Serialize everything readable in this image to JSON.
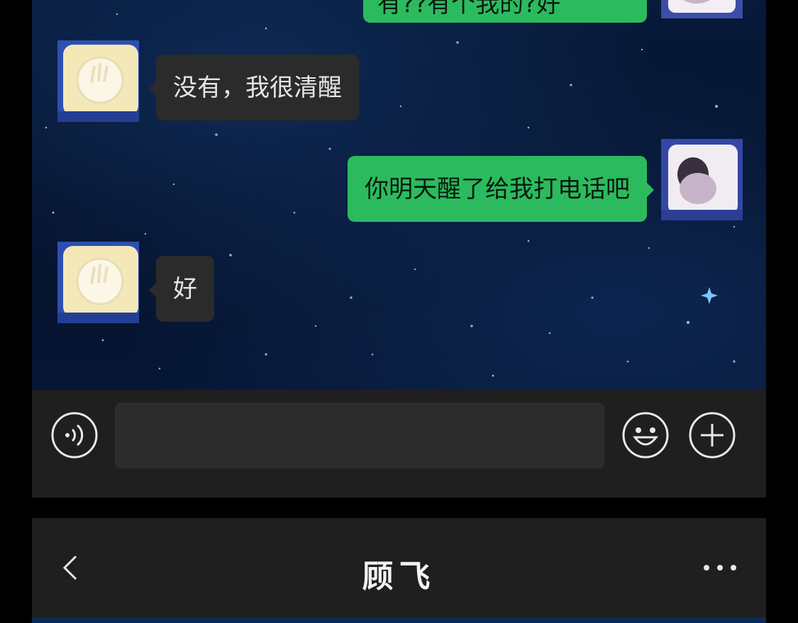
{
  "chat": {
    "partial_message": "有??有个我的?好",
    "messages": [
      {
        "side": "in",
        "text": "没有，我很清醒"
      },
      {
        "side": "out",
        "text": "你明天醒了给我打电话吧"
      },
      {
        "side": "in",
        "text": "好"
      }
    ]
  },
  "input_bar": {
    "voice_icon": "voice-icon",
    "emoji_icon": "emoji-icon",
    "plus_icon": "plus-icon"
  },
  "header": {
    "title": "顾飞",
    "back_icon": "back-icon",
    "more_icon": "more-icon"
  },
  "colors": {
    "bubble_out": "#2bbb5e",
    "bubble_in": "#2b2b2b",
    "bar_bg": "#1f1f1f"
  }
}
